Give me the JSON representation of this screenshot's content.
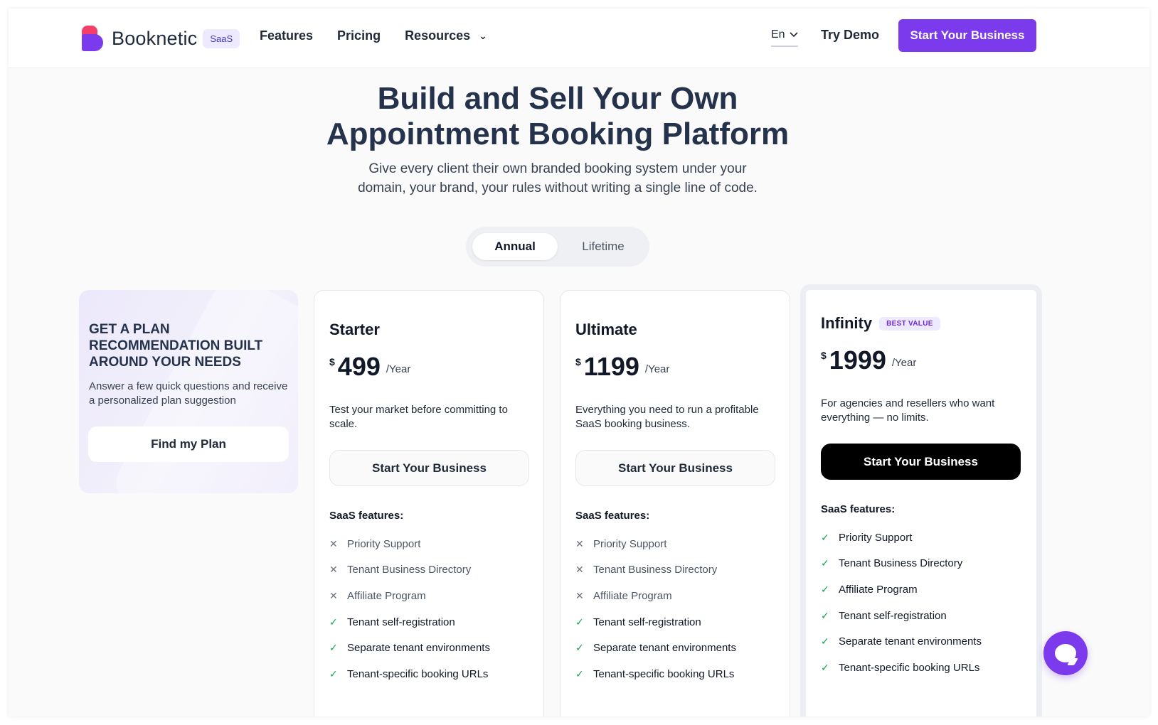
{
  "header": {
    "logo_text": "Booknetic",
    "badge": "SaaS",
    "nav": [
      {
        "label": "Features"
      },
      {
        "label": "Pricing"
      },
      {
        "label": "Resources"
      }
    ],
    "language": "En",
    "try_demo": "Try Demo",
    "cta": "Start Your Business"
  },
  "hero": {
    "title_line1": "Build and Sell Your Own",
    "title_line2": "Appointment Booking Platform",
    "subtitle_line1": "Give every client their own branded booking system under your",
    "subtitle_line2": "domain, your brand, your rules without writing a single line of code."
  },
  "billing_toggle": {
    "options": [
      "Annual",
      "Lifetime"
    ],
    "selected": "Annual"
  },
  "recommendation": {
    "title": "GET A PLAN RECOMMENDATION BUILT AROUND YOUR NEEDS",
    "description": "Answer a few quick questions and receive a personalized plan suggestion",
    "button": "Find my Plan"
  },
  "plans": [
    {
      "name": "Starter",
      "badge": "",
      "currency": "$",
      "price": "499",
      "period": "/Year",
      "description": "Test your market before committing to scale.",
      "button": "Start Your Business",
      "features_heading": "SaaS features:",
      "features": [
        {
          "label": "Priority Support",
          "included": false
        },
        {
          "label": "Tenant Business Directory",
          "included": false
        },
        {
          "label": "Affiliate Program",
          "included": false
        },
        {
          "label": "Tenant self-registration",
          "included": true
        },
        {
          "label": "Separate tenant environments",
          "included": true
        },
        {
          "label": "Tenant-specific booking URLs",
          "included": true
        }
      ]
    },
    {
      "name": "Ultimate",
      "badge": "",
      "currency": "$",
      "price": "1199",
      "period": "/Year",
      "description": "Everything you need to run a profitable SaaS booking business.",
      "button": "Start Your Business",
      "features_heading": "SaaS features:",
      "features": [
        {
          "label": "Priority Support",
          "included": false
        },
        {
          "label": "Tenant Business Directory",
          "included": false
        },
        {
          "label": "Affiliate Program",
          "included": false
        },
        {
          "label": "Tenant self-registration",
          "included": true
        },
        {
          "label": "Separate tenant environments",
          "included": true
        },
        {
          "label": "Tenant-specific booking URLs",
          "included": true
        }
      ]
    },
    {
      "name": "Infinity",
      "badge": "BEST VALUE",
      "currency": "$",
      "price": "1999",
      "period": "/Year",
      "description": "For agencies and resellers who want everything — no limits.",
      "button": "Start Your Business",
      "features_heading": "SaaS features:",
      "features": [
        {
          "label": "Priority Support",
          "included": true
        },
        {
          "label": "Tenant Business Directory",
          "included": true
        },
        {
          "label": "Affiliate Program",
          "included": true
        },
        {
          "label": "Tenant self-registration",
          "included": true
        },
        {
          "label": "Separate tenant environments",
          "included": true
        },
        {
          "label": "Tenant-specific booking URLs",
          "included": true
        }
      ]
    }
  ],
  "icons": {
    "check": "check-icon",
    "cross": "x-icon",
    "chat": "chat-icon"
  },
  "colors": {
    "brand": "#7c3aed",
    "logo_accent": "#f43f6a",
    "check": "#16a34a"
  }
}
